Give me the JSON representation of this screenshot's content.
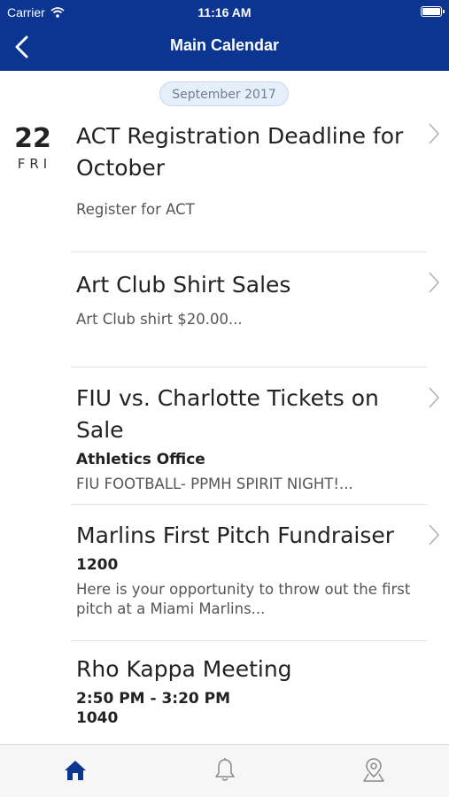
{
  "status_bar": {
    "carrier": "Carrier",
    "time": "11:16 AM"
  },
  "nav": {
    "title": "Main Calendar",
    "back_icon": "chevron-left-icon"
  },
  "month_label": "September 2017",
  "date": {
    "day_number": "22",
    "weekday": "FRI"
  },
  "events": [
    {
      "title": "ACT Registration Deadline for October",
      "subtitle": "",
      "description": "Register for ACT"
    },
    {
      "title": "Art Club Shirt Sales",
      "subtitle": "",
      "description": "Art Club shirt $20.00..."
    },
    {
      "title": "FIU vs. Charlotte Tickets on Sale",
      "subtitle": "Athletics Office",
      "description": "FIU FOOTBALL- PPMH SPIRIT NIGHT!..."
    },
    {
      "title": "Marlins First Pitch Fundraiser",
      "subtitle": "1200",
      "description": "Here is your opportunity to throw out the first pitch at a Miami Marlins..."
    },
    {
      "title": "Rho Kappa Meeting",
      "subtitle": "2:50 PM - 3:20 PM",
      "subtitle2": "1040",
      "description": ""
    }
  ],
  "tabs": [
    {
      "icon": "home-icon",
      "active": true
    },
    {
      "icon": "bell-icon",
      "active": false
    },
    {
      "icon": "map-pin-icon",
      "active": false
    }
  ],
  "colors": {
    "header": "#0b3591",
    "active_tab": "#0b3591",
    "inactive_tab": "#8a8a8a"
  }
}
